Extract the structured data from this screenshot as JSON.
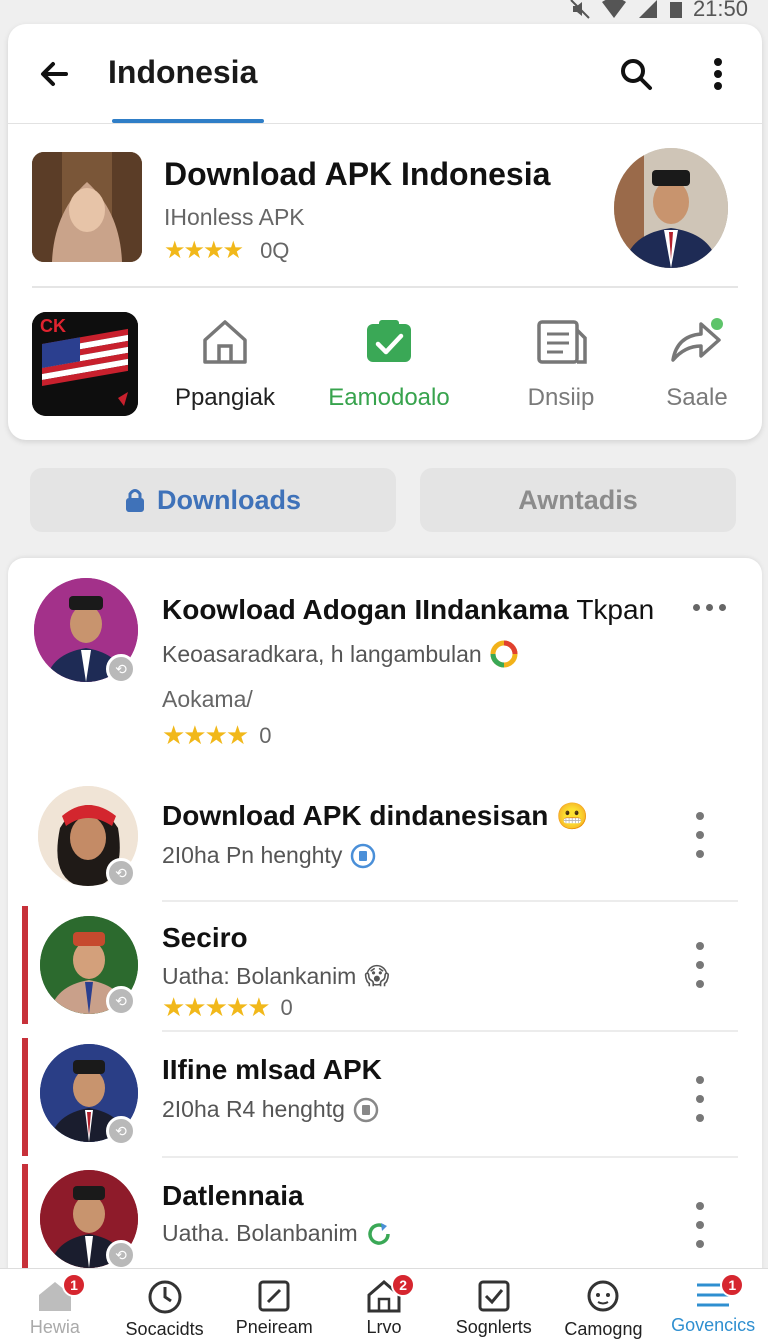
{
  "status_bar": {
    "time": "21:50"
  },
  "app_bar": {
    "title": "Indonesia"
  },
  "app": {
    "name": "Download APK Indonesia",
    "developer": "IHonless APK",
    "stars": "★★★★",
    "rating": "0Q"
  },
  "actions": [
    {
      "label": "Ppangiak",
      "icon": "home-icon"
    },
    {
      "label": "Eamodoalo",
      "icon": "download-check-icon"
    },
    {
      "label": "Dnsiip",
      "icon": "document-icon"
    },
    {
      "label": "Saale",
      "icon": "share-icon"
    }
  ],
  "flag_badge": "CK",
  "buttons": {
    "downloads": "Downloads",
    "second": "Awntadis"
  },
  "list": [
    {
      "title": "Koowload Adogan IIndankama",
      "title_suffix": "Tkpan",
      "subtitle": "Keoasaradkara, h langambulan",
      "meta": "Aokama/",
      "stars": "★★★★",
      "rating": "0"
    },
    {
      "title": "Download APK dindanesisan",
      "subtitle": "2I0ha Pn henghty"
    },
    {
      "title": "Seciro",
      "subtitle": "Uatha: Bolankanim",
      "stars": "★★★★★",
      "rating": "0"
    },
    {
      "title": "IIfine mlsad APK",
      "subtitle": "2I0ha R4 henghtg"
    },
    {
      "title": "Datlennaia",
      "subtitle": "Uatha. Bolanbanim"
    }
  ],
  "bottom_nav": [
    {
      "label": "Hewia",
      "icon": "home-icon",
      "badge": "1"
    },
    {
      "label": "Socacidts",
      "icon": "clock-icon"
    },
    {
      "label": "Pneiream",
      "icon": "edit-icon"
    },
    {
      "label": "Lrvo",
      "icon": "house-icon",
      "badge": "2"
    },
    {
      "label": "Sognlerts",
      "icon": "checkbox-icon"
    },
    {
      "label": "Camogng",
      "icon": "chat-icon"
    },
    {
      "label": "Govencics",
      "icon": "menu-icon",
      "badge": "1"
    }
  ],
  "colors": {
    "accent": "#2f7ec7",
    "active_green": "#37a34d",
    "star": "#f1b81a",
    "badge_red": "#d6262f"
  }
}
